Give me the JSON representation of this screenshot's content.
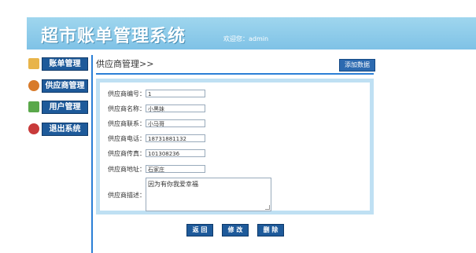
{
  "header": {
    "title": "超市账单管理系统",
    "welcome": "欢迎您：admin"
  },
  "sidebar": {
    "items": [
      {
        "label": "账单管理",
        "icon": "bill-icon",
        "color": "#e8b44a"
      },
      {
        "label": "供应商管理",
        "icon": "supplier-icon",
        "color": "#d87a2a"
      },
      {
        "label": "用户管理",
        "icon": "users-icon",
        "color": "#5aa84a"
      },
      {
        "label": "退出系统",
        "icon": "exit-icon",
        "color": "#c83a3a"
      }
    ]
  },
  "main": {
    "breadcrumb": "供应商管理>>",
    "add_button": "添加数据",
    "form": {
      "code_label": "供应商编号：",
      "code_value": "1",
      "name_label": "供应商名称：",
      "name_value": "小黑妹",
      "contact_label": "供应商联系：",
      "contact_value": "小马哥",
      "phone_label": "供应商电话：",
      "phone_value": "18731881132",
      "fax_label": "供应商传真：",
      "fax_value": "101308236",
      "address_label": "供应商地址：",
      "address_value": "石家庄",
      "desc_label": "供应商描述：",
      "desc_value": "因为有你我爱幸福"
    },
    "buttons": {
      "back": "返 回",
      "edit": "修 改",
      "delete": "删 除"
    }
  },
  "colors": {
    "accent": "#2b7fd6",
    "header": "#8fcbea",
    "button": "#1e5a9a"
  }
}
